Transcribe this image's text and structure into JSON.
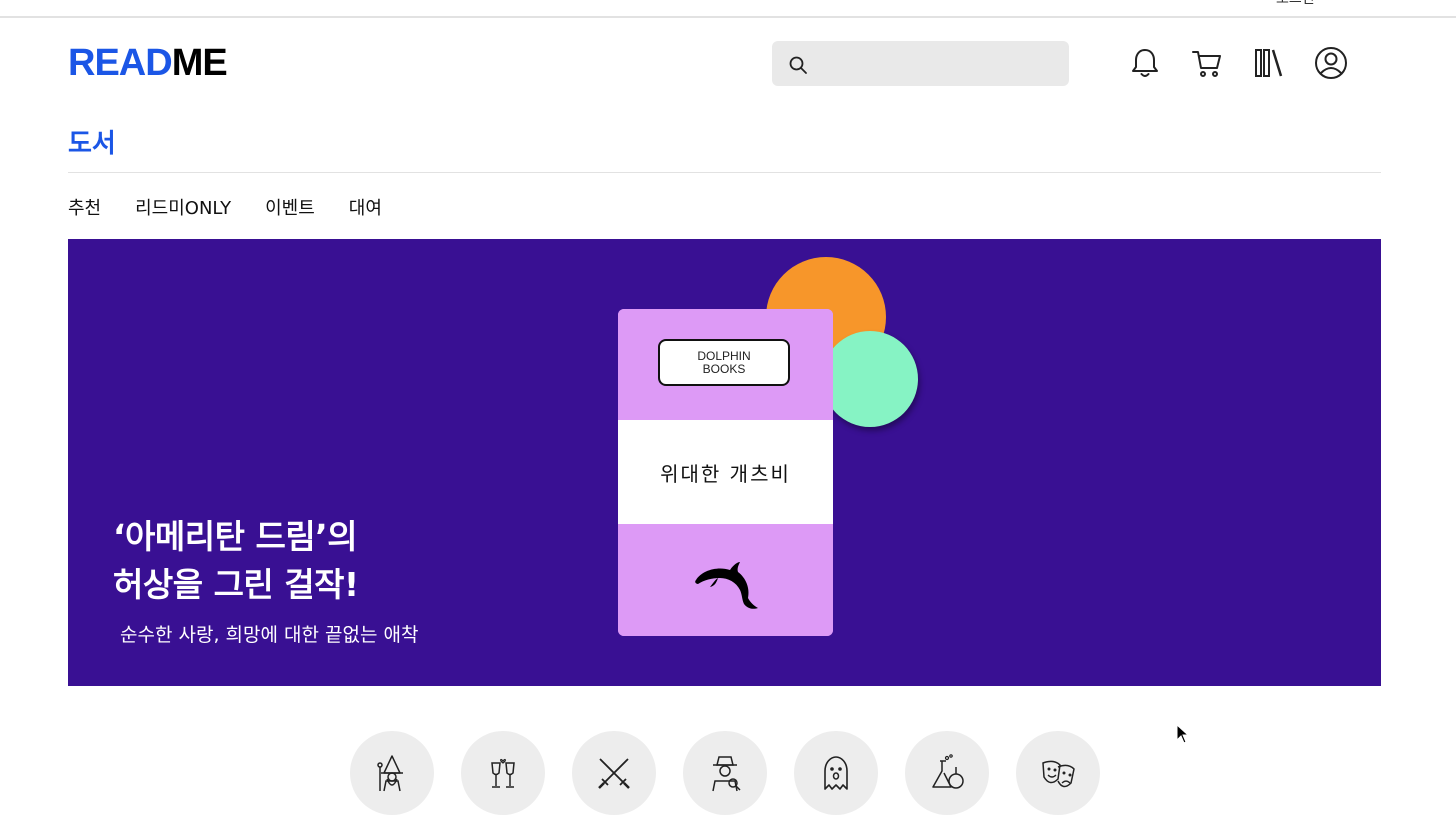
{
  "topbar": {
    "partial_text": "로그인"
  },
  "logo": {
    "part1": "READ",
    "part2": "ME"
  },
  "search": {
    "placeholder": ""
  },
  "header_icons": [
    "bell-icon",
    "cart-icon",
    "library-icon",
    "profile-icon"
  ],
  "page_title": "도서",
  "tabs": [
    "추천",
    "리드미ONLY",
    "이벤트",
    "대여"
  ],
  "banner": {
    "book_publisher_line1": "DOLPHIN",
    "book_publisher_line2": "BOOKS",
    "book_title": "위대한 개츠비",
    "headline_line1": "‘아메리탄 드림’의",
    "headline_line2": "허상을 그린 걸작!",
    "subtitle": "순수한 사랑, 희망에 대한 끝없는 애착",
    "colors": {
      "background": "#391093",
      "book": "#dd9af6",
      "orange": "#f7962a",
      "mint": "#86f3c4"
    }
  },
  "genre_icons": [
    "wizard-icon",
    "toast-icon",
    "crossed-swords-icon",
    "detective-icon",
    "ghost-icon",
    "science-flask-icon",
    "theater-masks-icon"
  ],
  "colors": {
    "brand": "#1b56e6"
  }
}
